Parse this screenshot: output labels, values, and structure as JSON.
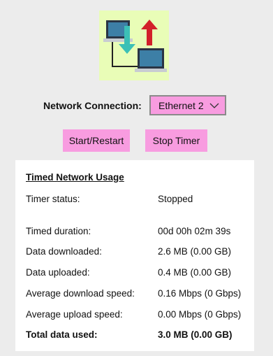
{
  "logo": {
    "icon": "network-transfer-icon",
    "background": "#e9fdb7"
  },
  "connection": {
    "label": "Network Connection:",
    "selected": "Ethernet 2",
    "icon": "chevron-down-icon"
  },
  "buttons": {
    "start_label": "Start/Restart",
    "stop_label": "Stop Timer",
    "color": "#f89ce0"
  },
  "usage": {
    "title": "Timed Network Usage",
    "timer_status_label": "Timer status:",
    "timer_status_value": "Stopped",
    "rows": [
      {
        "label": "Timed duration:",
        "value": "00d 00h 02m 39s"
      },
      {
        "label": "Data downloaded:",
        "value": "2.6 MB (0.00 GB)"
      },
      {
        "label": "Data uploaded:",
        "value": "0.4 MB (0.00 GB)"
      },
      {
        "label": "Average download speed:",
        "value": "0.16 Mbps (0 Gbps)"
      },
      {
        "label": "Average upload speed:",
        "value": "0.00 Mbps (0 Gbps)"
      }
    ],
    "total_label": "Total data used:",
    "total_value": "3.0 MB (0.00 GB)"
  }
}
